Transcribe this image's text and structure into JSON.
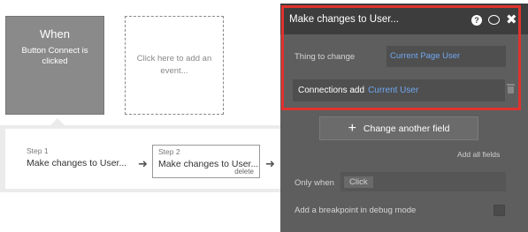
{
  "event": {
    "title": "When",
    "description": "Button Connect is clicked"
  },
  "add_event": {
    "label": "Click here to add an event..."
  },
  "steps": [
    {
      "label": "Step 1",
      "name": "Make changes to User..."
    },
    {
      "label": "Step 2",
      "name": "Make changes to User...",
      "delete_label": "delete"
    }
  ],
  "panel": {
    "title": "Make changes to User...",
    "help_icon": "?",
    "close_icon": "✖",
    "thing_to_change": {
      "label": "Thing to change",
      "value": "Current Page User"
    },
    "connections": {
      "label": "Connections add",
      "value": "Current User"
    },
    "change_another_field": {
      "icon": "+",
      "label": "Change another field"
    },
    "add_all_fields": "Add all fields",
    "only_when": {
      "label": "Only when",
      "placeholder": "Click"
    },
    "breakpoint": {
      "label": "Add a breakpoint in debug mode"
    }
  },
  "colors": {
    "highlight": "#e0322f",
    "link_blue": "#6fa8f0",
    "panel_bg": "#5e5e5e",
    "header_bg": "#3d3d3d"
  }
}
